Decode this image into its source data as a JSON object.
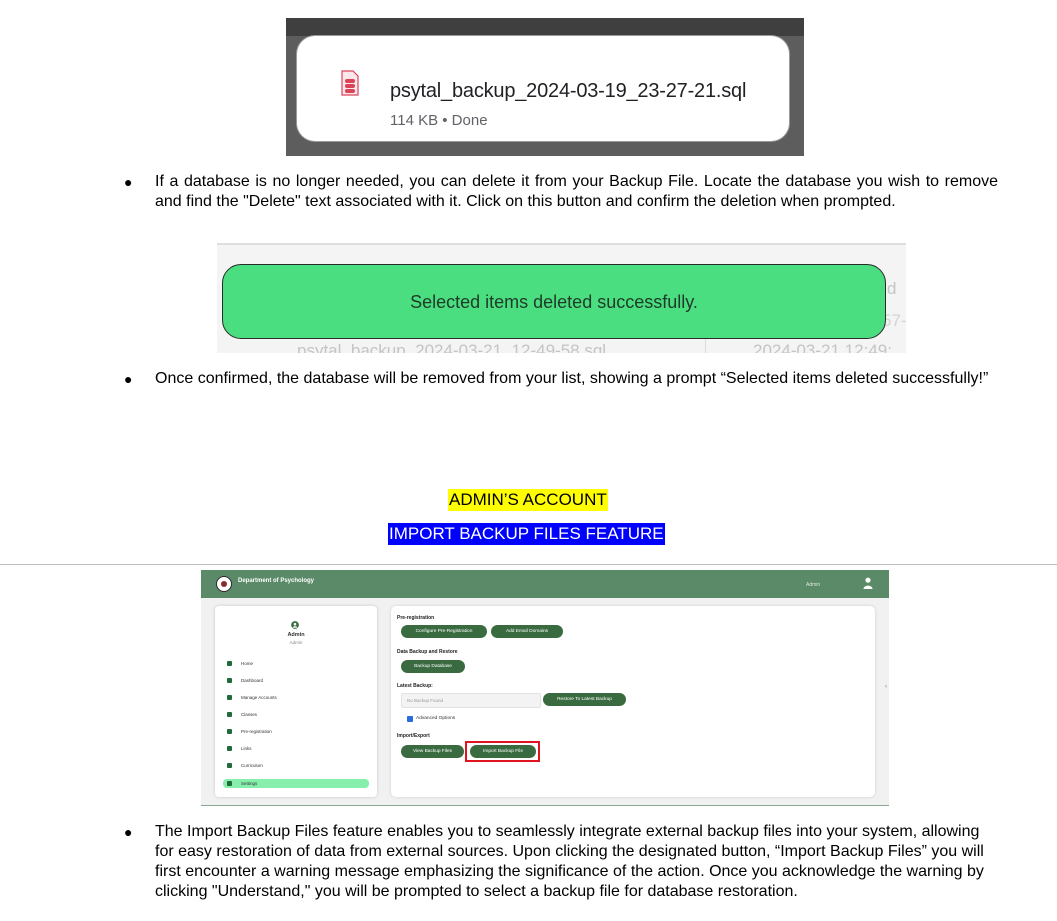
{
  "download_popup": {
    "filename": "psytal_backup_2024-03-19_23-27-21.sql",
    "meta": "114 KB • Done",
    "icon": "sql-file-icon"
  },
  "bullets": [
    {
      "marker": "●",
      "text": "If a database is no longer needed, you can delete it from your Backup File. Locate the database you wish to remove and find the \"Delete\" text associated with it. Click on this button and confirm the deletion when prompted."
    },
    {
      "marker": "●",
      "text": "Once confirmed, the database will be removed from your list, showing a prompt “Selected items deleted successfully!”"
    },
    {
      "marker": "●",
      "text": "The Import Backup Files feature enables you to seamlessly integrate external backup files into your system, allowing for easy restoration of data from external sources. Upon clicking the designated button, “Import Backup Files” you will first encounter a warning message emphasizing the significance of the action. Once you acknowledge the warning by clicking \"Understand,\" you will be prompted to select a backup file for database restoration."
    }
  ],
  "toast_screenshot": {
    "message": "Selected items deleted successfully.",
    "bg_row_text": "psytal_backup_2024-03-21_12-49-58.sql",
    "bg_row_date": "2024-03-21 12:49:",
    "bg_header_fragment": "d",
    "bg_row_fragment": "57-",
    "toast_color": "#4ade80"
  },
  "headings": {
    "section": "ADMIN’S ACCOUNT",
    "feature": "IMPORT BACKUP FILES FEATURE",
    "section_highlight": "#ffff00",
    "feature_highlight": "#0000ff"
  },
  "app_screenshot": {
    "header": {
      "title": "Department of Psychology",
      "user": "Admin",
      "color": "#5b8a68"
    },
    "sidebar": {
      "name": "Admin",
      "role": "Admin",
      "items": [
        {
          "label": "Home",
          "icon": "home-icon"
        },
        {
          "label": "Dashboard",
          "icon": "dashboard-icon"
        },
        {
          "label": "Manage Accounts",
          "icon": "manage-accounts-icon"
        },
        {
          "label": "Classes",
          "icon": "classes-icon"
        },
        {
          "label": "Pre-registration",
          "icon": "document-icon"
        },
        {
          "label": "Links",
          "icon": "link-icon"
        },
        {
          "label": "Curriculum",
          "icon": "graduation-cap-icon"
        },
        {
          "label": "Settings",
          "icon": "gear-icon"
        }
      ],
      "active": "Settings"
    },
    "main": {
      "preregistration_title": "Pre-registration",
      "configure_btn": "Configure Pre-Registration",
      "email_btn": "Add Email Domains",
      "backup_title": "Data Backup and Restore",
      "backup_btn": "Backup Database",
      "latest_title": "Latest Backup:",
      "latest_placeholder": "No Backup Found",
      "restore_btn": "Restore To Latest Backup",
      "advanced_label": "Advanced Options",
      "advanced_checked": true,
      "import_export_title": "Import/Export",
      "view_btn": "View Backup Files",
      "import_btn": "Import Backup File"
    }
  }
}
